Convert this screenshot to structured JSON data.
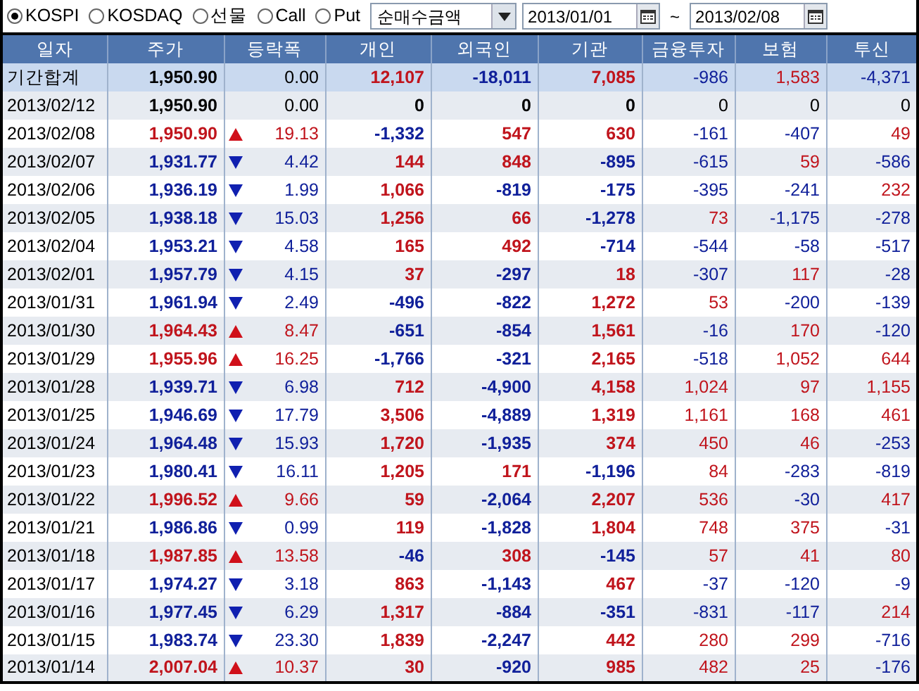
{
  "toolbar": {
    "markets": [
      {
        "label": "KOSPI",
        "selected": true
      },
      {
        "label": "KOSDAQ",
        "selected": false
      },
      {
        "label": "선물",
        "selected": false
      },
      {
        "label": "Call",
        "selected": false
      },
      {
        "label": "Put",
        "selected": false
      }
    ],
    "measure": "순매수금액",
    "date_from": "2013/01/01",
    "range_sep": "~",
    "date_to": "2013/02/08"
  },
  "table": {
    "columns": [
      "일자",
      "주가",
      "등락폭",
      "개인",
      "외국인",
      "기관",
      "금융투자",
      "보험",
      "투신"
    ],
    "summary": {
      "label": "기간합계",
      "price": "1,950.90",
      "change": "0.00",
      "values": [
        "12,107",
        "-18,011",
        "7,085",
        "-986",
        "1,583",
        "-4,371"
      ]
    },
    "rows": [
      {
        "date": "2013/02/12",
        "price": "1,950.90",
        "change": "0.00",
        "values": [
          "0",
          "0",
          "0",
          "0",
          "0",
          "0"
        ]
      },
      {
        "date": "2013/02/08",
        "price": "1,950.90",
        "kind": "up",
        "change": "19.13",
        "values": [
          "-1,332",
          "547",
          "630",
          "-161",
          "-407",
          "49"
        ]
      },
      {
        "date": "2013/02/07",
        "price": "1,931.77",
        "kind": "down",
        "change": "4.42",
        "values": [
          "144",
          "848",
          "-895",
          "-615",
          "59",
          "-586"
        ]
      },
      {
        "date": "2013/02/06",
        "price": "1,936.19",
        "kind": "down",
        "change": "1.99",
        "values": [
          "1,066",
          "-819",
          "-175",
          "-395",
          "-241",
          "232"
        ]
      },
      {
        "date": "2013/02/05",
        "price": "1,938.18",
        "kind": "down",
        "change": "15.03",
        "values": [
          "1,256",
          "66",
          "-1,278",
          "73",
          "-1,175",
          "-278"
        ]
      },
      {
        "date": "2013/02/04",
        "price": "1,953.21",
        "kind": "down",
        "change": "4.58",
        "values": [
          "165",
          "492",
          "-714",
          "-544",
          "-58",
          "-517"
        ]
      },
      {
        "date": "2013/02/01",
        "price": "1,957.79",
        "kind": "down",
        "change": "4.15",
        "values": [
          "37",
          "-297",
          "18",
          "-307",
          "117",
          "-28"
        ]
      },
      {
        "date": "2013/01/31",
        "price": "1,961.94",
        "kind": "down",
        "change": "2.49",
        "values": [
          "-496",
          "-822",
          "1,272",
          "53",
          "-200",
          "-139"
        ]
      },
      {
        "date": "2013/01/30",
        "price": "1,964.43",
        "kind": "up",
        "change": "8.47",
        "values": [
          "-651",
          "-854",
          "1,561",
          "-16",
          "170",
          "-120"
        ]
      },
      {
        "date": "2013/01/29",
        "price": "1,955.96",
        "kind": "up",
        "change": "16.25",
        "values": [
          "-1,766",
          "-321",
          "2,165",
          "-518",
          "1,052",
          "644"
        ]
      },
      {
        "date": "2013/01/28",
        "price": "1,939.71",
        "kind": "down",
        "change": "6.98",
        "values": [
          "712",
          "-4,900",
          "4,158",
          "1,024",
          "97",
          "1,155"
        ]
      },
      {
        "date": "2013/01/25",
        "price": "1,946.69",
        "kind": "down",
        "change": "17.79",
        "values": [
          "3,506",
          "-4,889",
          "1,319",
          "1,161",
          "168",
          "461"
        ]
      },
      {
        "date": "2013/01/24",
        "price": "1,964.48",
        "kind": "down",
        "change": "15.93",
        "values": [
          "1,720",
          "-1,935",
          "374",
          "450",
          "46",
          "-253"
        ]
      },
      {
        "date": "2013/01/23",
        "price": "1,980.41",
        "kind": "down",
        "change": "16.11",
        "values": [
          "1,205",
          "171",
          "-1,196",
          "84",
          "-283",
          "-819"
        ]
      },
      {
        "date": "2013/01/22",
        "price": "1,996.52",
        "kind": "up",
        "change": "9.66",
        "values": [
          "59",
          "-2,064",
          "2,207",
          "536",
          "-30",
          "417"
        ]
      },
      {
        "date": "2013/01/21",
        "price": "1,986.86",
        "kind": "down",
        "change": "0.99",
        "values": [
          "119",
          "-1,828",
          "1,804",
          "748",
          "375",
          "-31"
        ]
      },
      {
        "date": "2013/01/18",
        "price": "1,987.85",
        "kind": "up",
        "change": "13.58",
        "values": [
          "-46",
          "308",
          "-145",
          "57",
          "41",
          "80"
        ]
      },
      {
        "date": "2013/01/17",
        "price": "1,974.27",
        "kind": "down",
        "change": "3.18",
        "values": [
          "863",
          "-1,143",
          "467",
          "-37",
          "-120",
          "-9"
        ]
      },
      {
        "date": "2013/01/16",
        "price": "1,977.45",
        "kind": "down",
        "change": "6.29",
        "values": [
          "1,317",
          "-884",
          "-351",
          "-831",
          "-117",
          "214"
        ]
      },
      {
        "date": "2013/01/15",
        "price": "1,983.74",
        "kind": "down",
        "change": "23.30",
        "values": [
          "1,839",
          "-2,247",
          "442",
          "280",
          "299",
          "-716"
        ]
      },
      {
        "date": "2013/01/14",
        "price": "2,007.04",
        "kind": "up",
        "change": "10.37",
        "values": [
          "30",
          "-920",
          "985",
          "482",
          "25",
          "-176"
        ]
      }
    ]
  }
}
